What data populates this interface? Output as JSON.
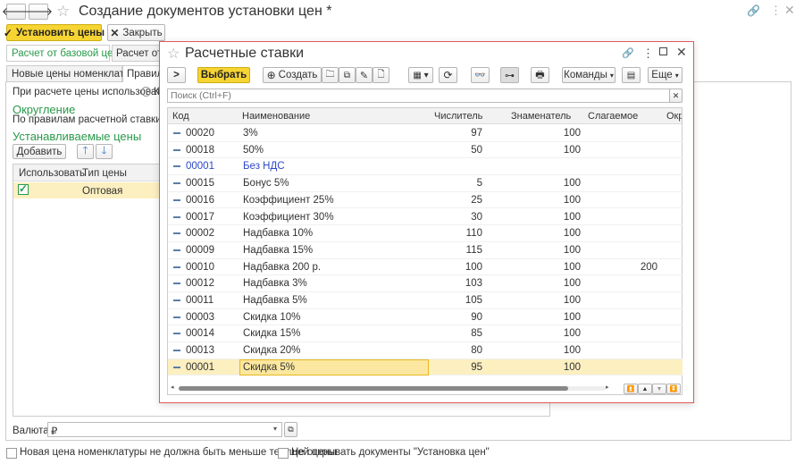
{
  "main": {
    "title": "Создание документов установки цен *",
    "set_prices": "Установить цены",
    "close": "Закрыть",
    "tabs_top": [
      "Новые цены номенклатуры",
      "Правила"
    ],
    "tabs_sub": [
      "Расчет от базовой цены",
      "Расчет от т"
    ],
    "use_label": "При расчете цены использовать:",
    "radio_partial": "К",
    "rounding_title": "Округление",
    "rounding_text": "По правилам расчетной ставки",
    "set_prices_title": "Устанавливаемые цены",
    "add": "Добавить",
    "grid_headers": [
      "Использовать",
      "Тип цены"
    ],
    "grid_row": "Оптовая",
    "currency_label": "Валюта:",
    "currency_value": "₽",
    "footer_check1": "Новая цена номенклатуры не должна быть меньше текущей цены",
    "footer_check2": "Не открывать документы \"Установка цен\""
  },
  "dialog": {
    "title": "Расчетные ставки",
    "select": "Выбрать",
    "create": "Создать",
    "commands": "Команды",
    "more": "Еще",
    "search_placeholder": "Поиск (Ctrl+F)",
    "headers": [
      "Код",
      "Наименование",
      "Числитель",
      "Знаменатель",
      "Слагаемое",
      "Окр"
    ],
    "rows": [
      {
        "code": "00020",
        "name": "3%",
        "num": "97",
        "den": "100",
        "add": ""
      },
      {
        "code": "00018",
        "name": "50%",
        "num": "50",
        "den": "100",
        "add": ""
      },
      {
        "code": "00001",
        "name": "Без НДС",
        "num": "",
        "den": "",
        "add": ""
      },
      {
        "code": "00015",
        "name": "Бонус 5%",
        "num": "5",
        "den": "100",
        "add": ""
      },
      {
        "code": "00016",
        "name": "Коэффициент 25%",
        "num": "25",
        "den": "100",
        "add": ""
      },
      {
        "code": "00017",
        "name": "Коэффициент 30%",
        "num": "30",
        "den": "100",
        "add": ""
      },
      {
        "code": "00002",
        "name": "Надбавка 10%",
        "num": "110",
        "den": "100",
        "add": ""
      },
      {
        "code": "00009",
        "name": "Надбавка 15%",
        "num": "115",
        "den": "100",
        "add": ""
      },
      {
        "code": "00010",
        "name": "Надбавка 200 р.",
        "num": "100",
        "den": "100",
        "add": "200"
      },
      {
        "code": "00012",
        "name": "Надбавка 3%",
        "num": "103",
        "den": "100",
        "add": ""
      },
      {
        "code": "00011",
        "name": "Надбавка 5%",
        "num": "105",
        "den": "100",
        "add": ""
      },
      {
        "code": "00003",
        "name": "Скидка 10%",
        "num": "90",
        "den": "100",
        "add": ""
      },
      {
        "code": "00014",
        "name": "Скидка 15%",
        "num": "85",
        "den": "100",
        "add": ""
      },
      {
        "code": "00013",
        "name": "Скидка 20%",
        "num": "80",
        "den": "100",
        "add": ""
      },
      {
        "code": "00001",
        "name": "Скидка 5%",
        "num": "95",
        "den": "100",
        "add": ""
      }
    ]
  },
  "colors": {
    "accent_yellow": "#f6d432",
    "green": "#2a9a4a",
    "dialog_border": "#e05a5a",
    "selected_row": "#fcefc0",
    "group_blue": "#2d48c8"
  }
}
